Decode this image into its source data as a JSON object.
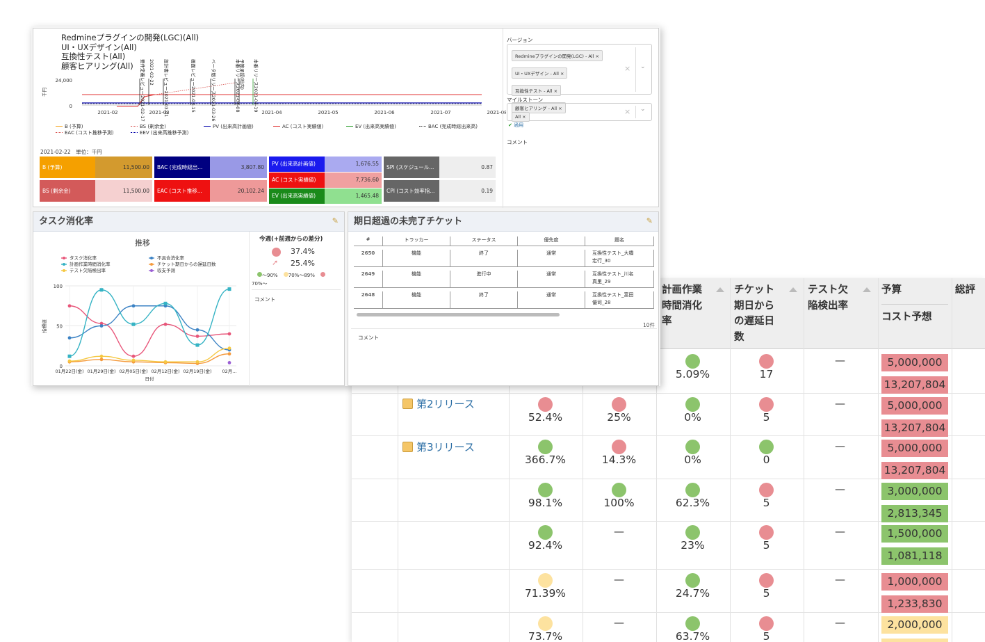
{
  "back_table": {
    "headers": [
      {
        "text": "計画作業\n時間消化\n率"
      },
      {
        "text": "チケット\n期日から\nの遅延日\n数"
      },
      {
        "text": "テスト欠\n陥検出率"
      },
      {
        "text": "予算"
      },
      {
        "text": "コスト予想"
      },
      {
        "text": "総評"
      }
    ],
    "releases": [
      "第2リリース",
      "第3リリース"
    ],
    "rows": [
      {
        "c1": "",
        "c2": "",
        "c3": "5.09%",
        "c4": "17",
        "c5": "—",
        "budget": "5,000,000",
        "cost": "13,207,804",
        "dots": [
          "",
          "",
          "g",
          "r"
        ],
        "budget_color": "#e88d92",
        "cost_color": "#e88d92"
      },
      {
        "c1": "52.4%",
        "c2": "25%",
        "c3": "0%",
        "c4": "5",
        "c5": "—",
        "budget": "5,000,000",
        "cost": "13,207,804",
        "dots": [
          "r",
          "r",
          "g",
          "r"
        ],
        "budget_color": "#e88d92",
        "cost_color": "#e88d92"
      },
      {
        "c1": "366.7%",
        "c2": "14.3%",
        "c3": "0%",
        "c4": "0",
        "c5": "—",
        "budget": "5,000,000",
        "cost": "13,207,804",
        "dots": [
          "g",
          "r",
          "g",
          "g"
        ],
        "budget_color": "#e88d92",
        "cost_color": "#e88d92"
      },
      {
        "c1": "98.1%",
        "c2": "100%",
        "c3": "62.3%",
        "c4": "5",
        "c5": "—",
        "budget": "3,000,000",
        "cost": "2,813,345",
        "dots": [
          "g",
          "g",
          "g",
          "r"
        ],
        "budget_color": "#8cc46c",
        "cost_color": "#8cc46c"
      },
      {
        "c1": "92.4%",
        "c2": "—",
        "c3": "23%",
        "c4": "5",
        "c5": "—",
        "budget": "1,500,000",
        "cost": "1,081,118",
        "dots": [
          "g",
          "",
          "g",
          "r"
        ],
        "budget_color": "#8cc46c",
        "cost_color": "#8cc46c"
      },
      {
        "c1": "71.39%",
        "c2": "—",
        "c3": "24.7%",
        "c4": "5",
        "c5": "—",
        "budget": "1,000,000",
        "cost": "1,233,830",
        "dots": [
          "y",
          "",
          "g",
          "r"
        ],
        "budget_color": "#e88d92",
        "cost_color": "#e88d92"
      },
      {
        "c1": "73.7%",
        "c2": "—",
        "c3": "63.7%",
        "c4": "5",
        "c5": "—",
        "budget": "2,000,000",
        "cost": "",
        "dots": [
          "y",
          "",
          "g",
          "r"
        ],
        "budget_color": "#fde29f",
        "cost_color": "#fde29f"
      }
    ]
  },
  "evm_panel": {
    "titles": [
      "Redmineプラグインの開発(LGC)(All)",
      "UI・UXデザイン(All)",
      "互換性テスト(All)",
      "顧客ヒアリング(All)"
    ],
    "y_unit": "千円",
    "y_ticks": [
      "24,000",
      "0"
    ],
    "x_ticks": [
      "2021-02",
      "2021-03",
      "2021-04",
      "2021-05",
      "2021-06",
      "2021-07",
      "2021-08"
    ],
    "milestones": [
      "要件定義レビュー2021-02-17",
      "2021-02-22",
      "設計書レビュー2021-03-01",
      "画面レビュー2021-03-15",
      "ベータ版リリース2021-03-26",
      "本番リリース2021-04-08",
      "予算承認(社内)",
      "本番リリース2021-04-19"
    ],
    "legend": [
      {
        "label": "B (予算)",
        "color": "#f5a623",
        "style": "solid"
      },
      {
        "label": "BS (剰余金)",
        "color": "#d9534f",
        "style": "dotted"
      },
      {
        "label": "PV (出来高計画値)",
        "color": "#0000aa",
        "style": "solid"
      },
      {
        "label": "AC (コスト実績値)",
        "color": "#e03030",
        "style": "solid"
      },
      {
        "label": "EV (出来高実績値)",
        "color": "#2a9d2a",
        "style": "solid"
      },
      {
        "label": "BAC (完成時総出来高)",
        "color": "#333333",
        "style": "dotted"
      },
      {
        "label": "EAC (コスト推移予測)",
        "color": "#d9534f",
        "style": "dotted"
      },
      {
        "label": "EEV (出来高推移予測)",
        "color": "#0000aa",
        "style": "dotted"
      }
    ],
    "date_unit": "2021-02-22　単位：千円",
    "kpis": {
      "b": {
        "label": "B (予算)",
        "value": "11,500.00"
      },
      "bs": {
        "label": "BS (剰余金)",
        "value": "11,500.00"
      },
      "bac": {
        "label": "BAC (完成時総出...",
        "value": "3,807.80"
      },
      "eac": {
        "label": "EAC (コスト推移...",
        "value": "20,102.24"
      },
      "pv": {
        "label": "PV (出来高計画値)",
        "value": "1,676.55"
      },
      "ac": {
        "label": "AC (コスト実績値)",
        "value": "7,736.60"
      },
      "ev": {
        "label": "EV (出来高実績値)",
        "value": "1,465.48"
      },
      "spi": {
        "label": "SPI (スケジュール...",
        "value": "0.87"
      },
      "cpi": {
        "label": "CPI (コスト効率指...",
        "value": "0.19"
      }
    },
    "filter": {
      "version_label": "バージョン",
      "version_tags": [
        "Redmineプラグインの開発(LGC) - All",
        "UI・UXデザイン - All",
        "互換性テスト - All",
        "顧客ヒアリング - All"
      ],
      "milestone_label": "マイルストーン",
      "milestone_tags": [
        "All"
      ],
      "apply": "適用",
      "comment": "コメント"
    }
  },
  "task_panel": {
    "title": "タスク消化率",
    "chart_title": "推移",
    "summary_title": "今週(+前週からの差分)",
    "summary_values": [
      "37.4%",
      "25.4%"
    ],
    "thresholds": [
      "〜90%",
      "70%〜89%",
      "70%〜"
    ],
    "comment": "コメント",
    "chart_data": {
      "type": "line",
      "x": [
        "01月22日(金)",
        "01月29日(金)",
        "02月05日(金)",
        "02月12日(金)",
        "02月19日(金)",
        "02月..."
      ],
      "xlabel": "日付",
      "ylabel": "指標値",
      "ylim": [
        0,
        100
      ],
      "y_ticks": [
        "100",
        "50",
        "0"
      ],
      "series": [
        {
          "name": "タスク消化率",
          "color": "#e8567a",
          "values": [
            75,
            53,
            12,
            52,
            37,
            40
          ]
        },
        {
          "name": "不具合消化率",
          "color": "#3b82c4",
          "values": [
            35,
            50,
            75,
            75,
            45,
            20
          ]
        },
        {
          "name": "計画作業時間消化率",
          "color": "#35b3c4",
          "values": [
            12,
            95,
            52,
            78,
            26,
            96
          ]
        },
        {
          "name": "チケット期日からの遅延日数",
          "color": "#f59a3c",
          "values": [
            5,
            8,
            5,
            4,
            3,
            15
          ]
        },
        {
          "name": "テスト欠陥検出率",
          "color": "#f5c842",
          "values": [
            6,
            12,
            7,
            5,
            5,
            22
          ]
        },
        {
          "name": "収支予測",
          "color": "#9b5fd4",
          "values": [
            null,
            null,
            null,
            null,
            null,
            4
          ]
        }
      ]
    }
  },
  "ticket_panel": {
    "title": "期日超過の未完了チケット",
    "columns": [
      "#",
      "トラッカー",
      "ステータス",
      "優先度",
      "題名"
    ],
    "rows": [
      {
        "id": "2650",
        "tracker": "機能",
        "status": "終了",
        "priority": "通常",
        "subject": "互換性テスト_大橋\n宏行_30"
      },
      {
        "id": "2649",
        "tracker": "機能",
        "status": "進行中",
        "priority": "通常",
        "subject": "互換性テスト_川名\n真里_29"
      },
      {
        "id": "2648",
        "tracker": "機能",
        "status": "終了",
        "priority": "通常",
        "subject": "互換性テスト_富田\n優司_28"
      }
    ],
    "count": "10件",
    "comment": "コメント"
  }
}
